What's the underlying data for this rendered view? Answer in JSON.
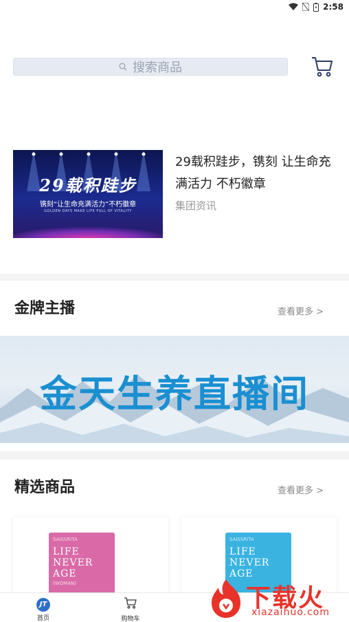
{
  "status_bar": {
    "time": "2:58"
  },
  "search": {
    "placeholder": "搜索商品"
  },
  "news": {
    "thumb_title": "29载积跬步",
    "thumb_subtitle": "镌刻“让生命充满活力”不朽徽章",
    "thumb_english": "GOLDEN DAYS MAKE LIFE FULL OF VITALITY",
    "title": "29载积跬步，镌刻 让生命充满活力 不朽徽章",
    "category": "集团资讯"
  },
  "sections": {
    "gold_anchor": {
      "title": "金牌主播",
      "more": "查看更多 >"
    },
    "featured": {
      "title": "精选商品",
      "more": "查看更多 >"
    }
  },
  "banner": {
    "text": "金天生养直播间"
  },
  "products": [
    {
      "brand": "SAISSRITA",
      "lines": [
        "LIFE",
        "NEVER",
        "AGE"
      ],
      "sub": "(WOMAN)",
      "color": "#d96aa7"
    },
    {
      "brand": "SAISSRITA",
      "lines": [
        "LIFE",
        "NEVER",
        "AGE"
      ],
      "sub": "",
      "color": "#3ab3e0"
    }
  ],
  "tabs": [
    {
      "label": "首页",
      "icon": "home-icon"
    },
    {
      "label": "购物车",
      "icon": "cart-icon"
    }
  ],
  "watermark": {
    "main": "下载火",
    "sub": "xiazaihuo.com"
  },
  "colors": {
    "accent": "#2f6fc9",
    "banner_text": "#1a8fd1",
    "watermark": "#e8332a"
  }
}
